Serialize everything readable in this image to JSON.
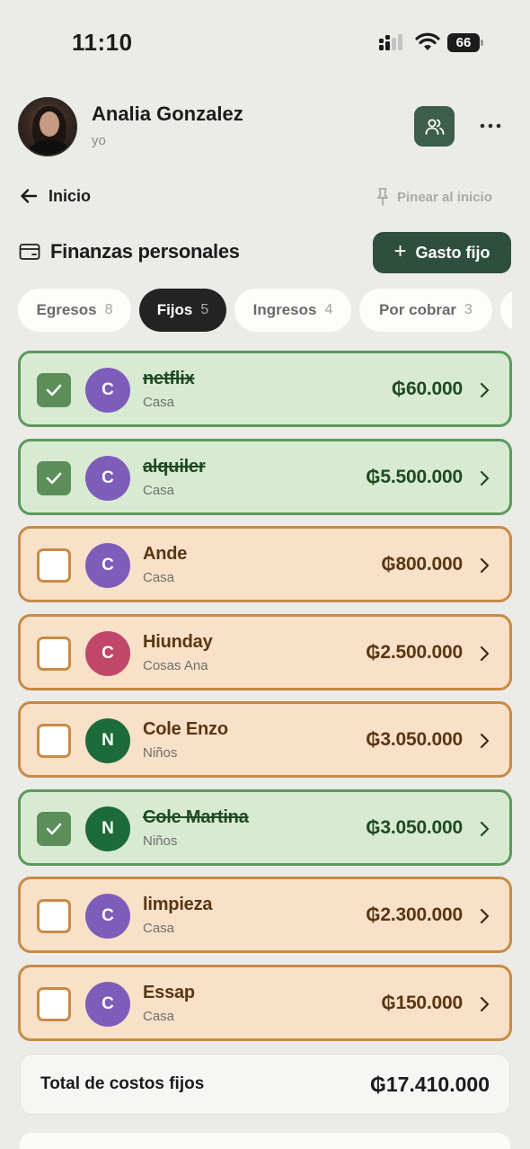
{
  "status_bar": {
    "time": "11:10",
    "battery": "66"
  },
  "profile": {
    "name": "Analia Gonzalez",
    "subtitle": "yo"
  },
  "nav": {
    "back_label": "Inicio",
    "pin_label": "Pinear al inicio"
  },
  "section": {
    "title": "Finanzas personales",
    "add_label": "Gasto fijo"
  },
  "tabs": [
    {
      "label": "Egresos",
      "count": "8",
      "active": false
    },
    {
      "label": "Fijos",
      "count": "5",
      "active": true
    },
    {
      "label": "Ingresos",
      "count": "4",
      "active": false
    },
    {
      "label": "Por cobrar",
      "count": "3",
      "active": false
    }
  ],
  "items": [
    {
      "name": "netflix",
      "category": "Casa",
      "amount": "₲60.000",
      "initial": "C",
      "paid": true,
      "avatar_color": "#7d5cba"
    },
    {
      "name": "alquiler",
      "category": "Casa",
      "amount": "₲5.500.000",
      "initial": "C",
      "paid": true,
      "avatar_color": "#7d5cba"
    },
    {
      "name": "Ande",
      "category": "Casa",
      "amount": "₲800.000",
      "initial": "C",
      "paid": false,
      "avatar_color": "#7d5cba"
    },
    {
      "name": "Hiunday",
      "category": "Cosas Ana",
      "amount": "₲2.500.000",
      "initial": "C",
      "paid": false,
      "avatar_color": "#c0476a"
    },
    {
      "name": "Cole Enzo",
      "category": "Niños",
      "amount": "₲3.050.000",
      "initial": "N",
      "paid": false,
      "avatar_color": "#1e6b3a"
    },
    {
      "name": "Cole Martina",
      "category": "Niños",
      "amount": "₲3.050.000",
      "initial": "N",
      "paid": true,
      "avatar_color": "#1e6b3a"
    },
    {
      "name": "limpieza",
      "category": "Casa",
      "amount": "₲2.300.000",
      "initial": "C",
      "paid": false,
      "avatar_color": "#7d5cba"
    },
    {
      "name": "Essap",
      "category": "Casa",
      "amount": "₲150.000",
      "initial": "C",
      "paid": false,
      "avatar_color": "#7d5cba"
    }
  ],
  "total": {
    "label": "Total de costos fijos",
    "value": "₲17.410.000"
  },
  "icons": {
    "back": "arrow-left-icon",
    "pin": "pin-icon",
    "people": "people-icon",
    "more": "more-dots-icon",
    "wallet": "wallet-icon",
    "check": "check-icon",
    "chevron": "chevron-right-icon"
  }
}
